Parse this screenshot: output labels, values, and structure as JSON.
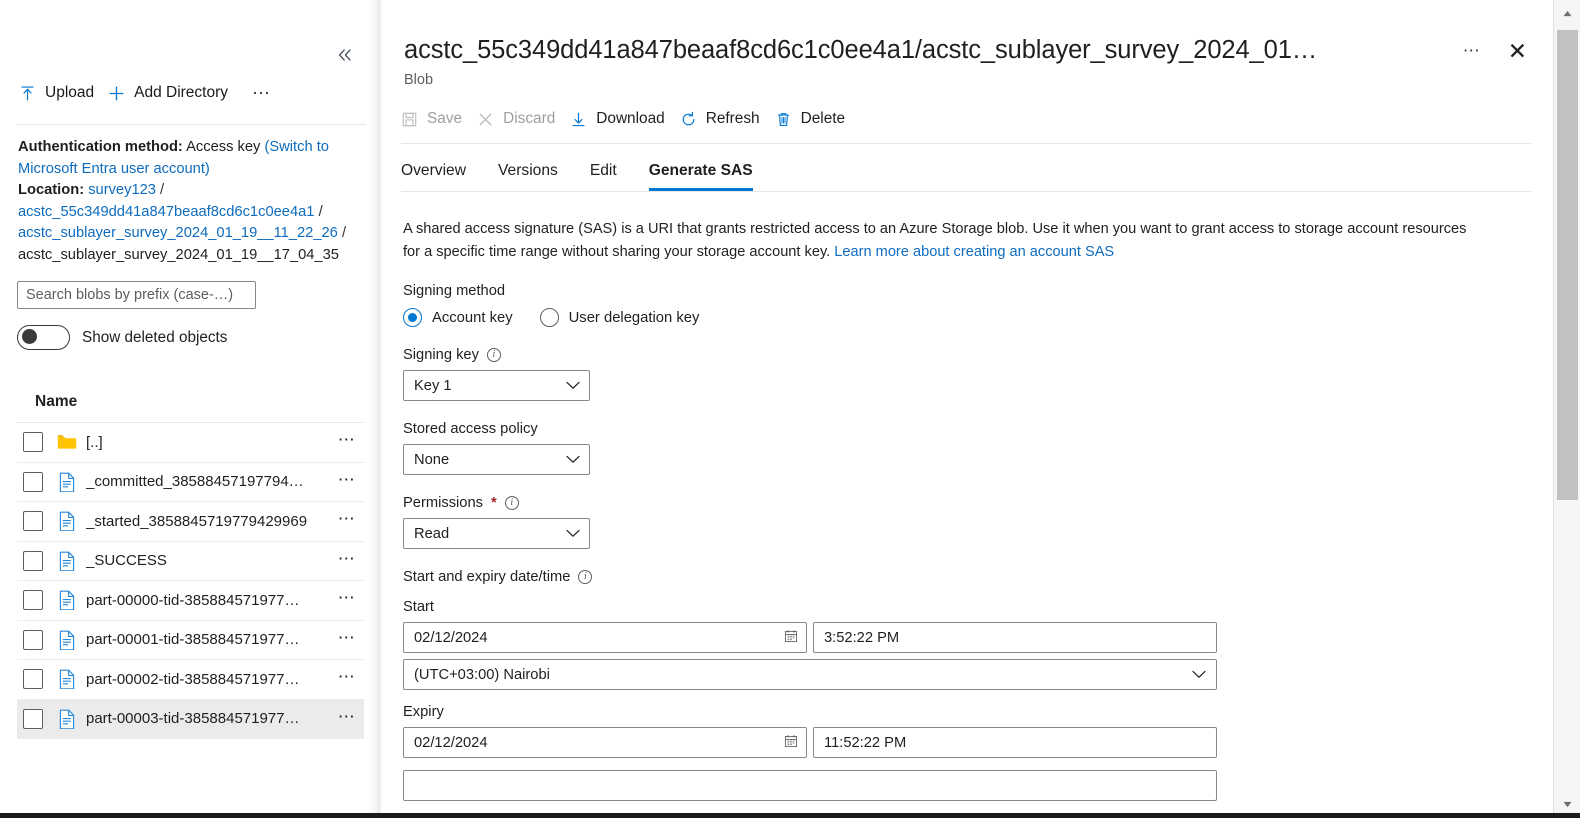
{
  "sidebar": {
    "collapse_icon": "chevron-double-left-icon",
    "toolbar": {
      "upload_label": "Upload",
      "upload_icon": "upload-arrow-icon",
      "add_directory_label": "Add Directory",
      "add_directory_icon": "plus-icon",
      "more_label": "⋯"
    },
    "auth": {
      "label": "Authentication method:",
      "value": "Access key",
      "switch_link": "(Switch to Microsoft Entra user account)"
    },
    "location": {
      "label": "Location:",
      "account": "survey123",
      "container": "acstc_55c349dd41a847beaaf8cd6c1c0ee4a1",
      "folder": "acstc_sublayer_survey_2024_01_19__11_22_26",
      "current": "acstc_sublayer_survey_2024_01_19__17_04_35",
      "separator": "/"
    },
    "search": {
      "placeholder": "Search blobs by prefix (case-…)",
      "value": ""
    },
    "show_deleted_label": "Show deleted objects",
    "show_deleted_state": "off",
    "column_header_name": "Name",
    "rows": [
      {
        "name": "[..]",
        "icon": "folder-icon",
        "type": "folder",
        "selected": false
      },
      {
        "name": "_committed_38588457197794…",
        "icon": "file-icon",
        "type": "blob",
        "selected": false
      },
      {
        "name": "_started_3858845719779429969",
        "icon": "file-icon",
        "type": "blob",
        "selected": false
      },
      {
        "name": "_SUCCESS",
        "icon": "file-icon",
        "type": "blob",
        "selected": false
      },
      {
        "name": "part-00000-tid-385884571977…",
        "icon": "file-icon",
        "type": "blob",
        "selected": false
      },
      {
        "name": "part-00001-tid-385884571977…",
        "icon": "file-icon",
        "type": "blob",
        "selected": false
      },
      {
        "name": "part-00002-tid-385884571977…",
        "icon": "file-icon",
        "type": "blob",
        "selected": false
      },
      {
        "name": "part-00003-tid-385884571977…",
        "icon": "file-icon",
        "type": "blob",
        "selected": true
      }
    ],
    "row_more_label": "⋯"
  },
  "blade": {
    "title": "acstc_55c349dd41a847beaaf8cd6c1c0ee4a1/acstc_sublayer_survey_2024_01…",
    "subtitle": "Blob",
    "more_label": "⋯",
    "close_label": "✕",
    "commands": [
      {
        "label": "Save",
        "icon": "save-disk-icon",
        "disabled": true
      },
      {
        "label": "Discard",
        "icon": "close-x-icon",
        "disabled": true
      },
      {
        "label": "Download",
        "icon": "download-arrow-icon",
        "disabled": false
      },
      {
        "label": "Refresh",
        "icon": "refresh-circle-icon",
        "disabled": false
      },
      {
        "label": "Delete",
        "icon": "trash-icon",
        "disabled": false
      }
    ],
    "tabs": [
      {
        "label": "Overview",
        "active": false
      },
      {
        "label": "Versions",
        "active": false
      },
      {
        "label": "Edit",
        "active": false
      },
      {
        "label": "Generate SAS",
        "active": true
      }
    ]
  },
  "sas": {
    "description_part1": "A shared access signature (SAS) is a URI that grants restricted access to an Azure Storage blob. Use it when you want to grant access to storage account resources for a specific time range without sharing your storage account key. ",
    "description_link": "Learn more about creating an account SAS",
    "signing_method": {
      "label": "Signing method",
      "options": [
        {
          "label": "Account key",
          "selected": true
        },
        {
          "label": "User delegation key",
          "selected": false
        }
      ]
    },
    "signing_key": {
      "label": "Signing key",
      "value": "Key 1",
      "info_icon": "info-icon",
      "chevron_icon": "chevron-down-icon"
    },
    "stored_access_policy": {
      "label": "Stored access policy",
      "value": "None",
      "chevron_icon": "chevron-down-icon"
    },
    "permissions": {
      "label": "Permissions",
      "required_marker": "*",
      "value": "Read",
      "info_icon": "info-icon",
      "chevron_icon": "chevron-down-icon"
    },
    "datetime": {
      "group_label": "Start and expiry date/time",
      "info_icon": "info-icon",
      "start_label": "Start",
      "start_date": "02/12/2024",
      "start_time": "3:52:22 PM",
      "calendar_icon": "calendar-icon",
      "timezone": "(UTC+03:00) Nairobi",
      "timezone_chevron_icon": "chevron-down-icon",
      "expiry_label": "Expiry",
      "expiry_date": "02/12/2024",
      "expiry_time": "11:52:22 PM"
    }
  },
  "scrollbar": {
    "up_icon": "triangle-up-icon",
    "down_icon": "triangle-down-icon"
  },
  "colors": {
    "accent": "#0078d4",
    "link": "#0f6cbd",
    "required": "#a4262c",
    "folder": "#ffc300",
    "selected_row": "#ebebeb"
  }
}
